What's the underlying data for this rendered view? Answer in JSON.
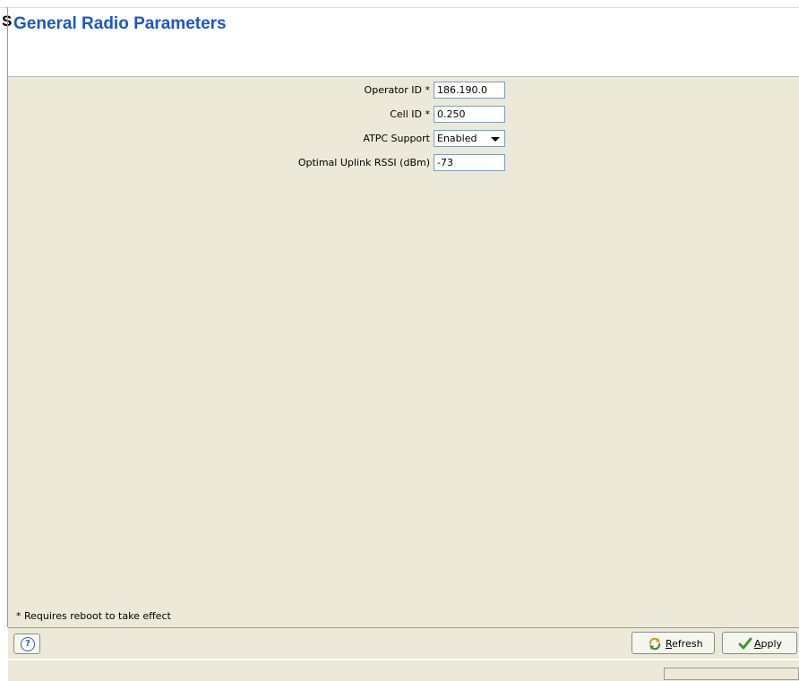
{
  "header": {
    "stray_glyph": "S",
    "title": "General Radio Parameters"
  },
  "form": {
    "operator_id": {
      "label": "Operator ID *",
      "value": "186.190.0"
    },
    "cell_id": {
      "label": "Cell ID *",
      "value": "0.250"
    },
    "atpc_support": {
      "label": "ATPC Support",
      "value": "Enabled"
    },
    "optimal_uplink_rssi": {
      "label": "Optimal Uplink RSSI (dBm)",
      "value": "-73"
    }
  },
  "footer": {
    "note": "* Requires reboot to take effect",
    "help_icon": "?",
    "refresh": {
      "first": "R",
      "rest": "efresh"
    },
    "apply": {
      "first": "A",
      "rest": "pply"
    }
  },
  "colors": {
    "title": "#1e55c8",
    "panel_background": "#ece9d8"
  },
  "icons": {
    "help": "help-icon",
    "refresh": "refresh-icon",
    "apply": "checkmark-icon"
  }
}
